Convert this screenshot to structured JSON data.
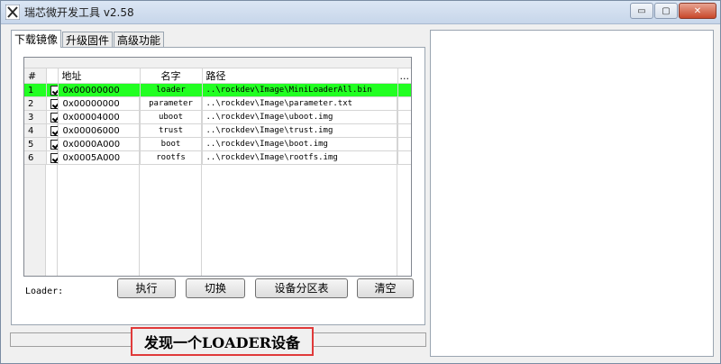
{
  "window": {
    "title": "瑞芯微开发工具 v2.58",
    "icon": "rockchip-tool-icon",
    "buttons": {
      "minimize": "▭",
      "maximize": "▢",
      "close": "✕"
    }
  },
  "tabs": [
    {
      "label": "下载镜像",
      "active": true
    },
    {
      "label": "升级固件",
      "active": false
    },
    {
      "label": "高级功能",
      "active": false
    }
  ],
  "table": {
    "columns": [
      "#",
      "",
      "地址",
      "名字",
      "路径",
      "..."
    ],
    "rows": [
      {
        "num": "1",
        "checked": true,
        "addr": "0x00000000",
        "name": "loader",
        "path": "..\\rockdev\\Image\\MiniLoaderAll.bin",
        "selected": true
      },
      {
        "num": "2",
        "checked": true,
        "addr": "0x00000000",
        "name": "parameter",
        "path": "..\\rockdev\\Image\\parameter.txt",
        "selected": false
      },
      {
        "num": "3",
        "checked": true,
        "addr": "0x00004000",
        "name": "uboot",
        "path": "..\\rockdev\\Image\\uboot.img",
        "selected": false
      },
      {
        "num": "4",
        "checked": true,
        "addr": "0x00006000",
        "name": "trust",
        "path": "..\\rockdev\\Image\\trust.img",
        "selected": false
      },
      {
        "num": "5",
        "checked": true,
        "addr": "0x0000A000",
        "name": "boot",
        "path": "..\\rockdev\\Image\\boot.img",
        "selected": false
      },
      {
        "num": "6",
        "checked": true,
        "addr": "0x0005A000",
        "name": "rootfs",
        "path": "..\\rockdev\\Image\\rootfs.img",
        "selected": false
      }
    ]
  },
  "loader_label": "Loader:",
  "buttons": {
    "execute": "执行",
    "switch": "切换",
    "partition_table": "设备分区表",
    "clear": "清空"
  },
  "status": {
    "text": "发现一个LOADER设备",
    "highlight_color": "#e03a3a"
  },
  "colors": {
    "selected_row": "#22ff22"
  }
}
